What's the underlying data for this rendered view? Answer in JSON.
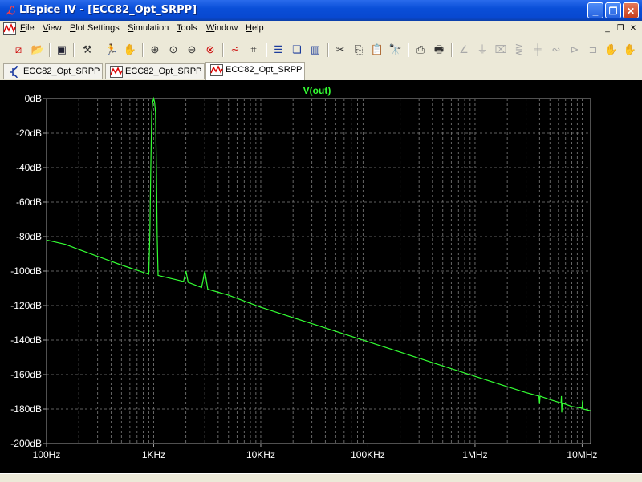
{
  "window": {
    "title": "LTspice IV - [ECC82_Opt_SRPP]",
    "app_icon": "ltspice-logo-icon",
    "minimize": "_",
    "maximize": "❐",
    "close": "✕"
  },
  "menu": {
    "items": [
      {
        "label": "File",
        "u": "F",
        "rest": "ile"
      },
      {
        "label": "View",
        "u": "V",
        "rest": "iew"
      },
      {
        "label": "Plot Settings",
        "u": "P",
        "rest": "lot Settings"
      },
      {
        "label": "Simulation",
        "u": "S",
        "rest": "imulation"
      },
      {
        "label": "Tools",
        "u": "T",
        "rest": "ools"
      },
      {
        "label": "Window",
        "u": "W",
        "rest": "indow"
      },
      {
        "label": "Help",
        "u": "H",
        "rest": "elp"
      }
    ],
    "mdi_minimize": "_",
    "mdi_restore": "❐",
    "mdi_close": "✕"
  },
  "toolbar": {
    "icons": [
      "new-schematic-icon",
      "open-icon",
      "save-icon",
      "control-panel-icon",
      "run-icon",
      "halt-icon",
      "zoom-in-icon",
      "zoom-pan-icon",
      "zoom-out-icon",
      "zoom-cancel-icon",
      "autorange-icon",
      "measure-icon",
      "tile-horizontal-icon",
      "cascade-icon",
      "tile-vertical-icon",
      "cut-icon",
      "copy-icon",
      "paste-icon",
      "find-icon",
      "print-setup-icon",
      "print-icon",
      "wire-icon",
      "ground-icon",
      "label-icon",
      "resistor-icon",
      "capacitor-icon",
      "inductor-icon",
      "diode-icon",
      "component-icon",
      "move-icon"
    ]
  },
  "tabs": [
    {
      "label": "ECC82_Opt_SRPP",
      "kind": "schematic",
      "active": false
    },
    {
      "label": "ECC82_Opt_SRPP",
      "kind": "waveform",
      "active": false
    },
    {
      "label": "ECC82_Opt_SRPP",
      "kind": "waveform",
      "active": true
    }
  ],
  "colors": {
    "trace": "#33ff33",
    "grid": "#7f7f7f",
    "axis_text": "#ffffff",
    "background": "#000000"
  },
  "chart_data": {
    "type": "line",
    "title": "V(out)",
    "xscale": "log",
    "xlim": [
      100,
      12000000
    ],
    "ylim": [
      -200,
      0
    ],
    "x_ticks": [
      {
        "v": 100,
        "label": "100Hz"
      },
      {
        "v": 1000,
        "label": "1KHz"
      },
      {
        "v": 10000,
        "label": "10KHz"
      },
      {
        "v": 100000,
        "label": "100KHz"
      },
      {
        "v": 1000000,
        "label": "1MHz"
      },
      {
        "v": 10000000,
        "label": "10MHz"
      }
    ],
    "y_ticks": [
      {
        "v": 0,
        "label": "0dB"
      },
      {
        "v": -20,
        "label": "-20dB"
      },
      {
        "v": -40,
        "label": "-40dB"
      },
      {
        "v": -60,
        "label": "-60dB"
      },
      {
        "v": -80,
        "label": "-80dB"
      },
      {
        "v": -100,
        "label": "-100dB"
      },
      {
        "v": -120,
        "label": "-120dB"
      },
      {
        "v": -140,
        "label": "-140dB"
      },
      {
        "v": -160,
        "label": "-160dB"
      },
      {
        "v": -180,
        "label": "-180dB"
      },
      {
        "v": -200,
        "label": "-200dB"
      }
    ],
    "grid": true,
    "series": [
      {
        "name": "V(out)",
        "points": [
          [
            100,
            -82
          ],
          [
            150,
            -84.5
          ],
          [
            200,
            -87.5
          ],
          [
            300,
            -91.5
          ],
          [
            500,
            -96.5
          ],
          [
            700,
            -99.5
          ],
          [
            900,
            -101.8
          ],
          [
            920,
            -80
          ],
          [
            940,
            -40
          ],
          [
            960,
            -8
          ],
          [
            980,
            -2
          ],
          [
            1000,
            0
          ],
          [
            1020,
            -2
          ],
          [
            1040,
            -8
          ],
          [
            1060,
            -40
          ],
          [
            1080,
            -80
          ],
          [
            1100,
            -102.5
          ],
          [
            1900,
            -106
          ],
          [
            2000,
            -100
          ],
          [
            2100,
            -106.5
          ],
          [
            2800,
            -109.5
          ],
          [
            3000,
            -100
          ],
          [
            3200,
            -110.5
          ],
          [
            5000,
            -114
          ],
          [
            10000,
            -121
          ],
          [
            100000,
            -141
          ],
          [
            1000000,
            -161
          ],
          [
            3000000,
            -170.5
          ],
          [
            3950000,
            -172.5
          ],
          [
            4000000,
            -177
          ],
          [
            4050000,
            -172.5
          ],
          [
            5000000,
            -174.5
          ],
          [
            6350000,
            -176.5
          ],
          [
            6400000,
            -172.5
          ],
          [
            6450000,
            -182
          ],
          [
            6500000,
            -176.5
          ],
          [
            8000000,
            -178.5
          ],
          [
            10000000,
            -179.5
          ],
          [
            10100000,
            -175
          ],
          [
            10200000,
            -180
          ],
          [
            12000000,
            -181
          ]
        ]
      }
    ]
  }
}
